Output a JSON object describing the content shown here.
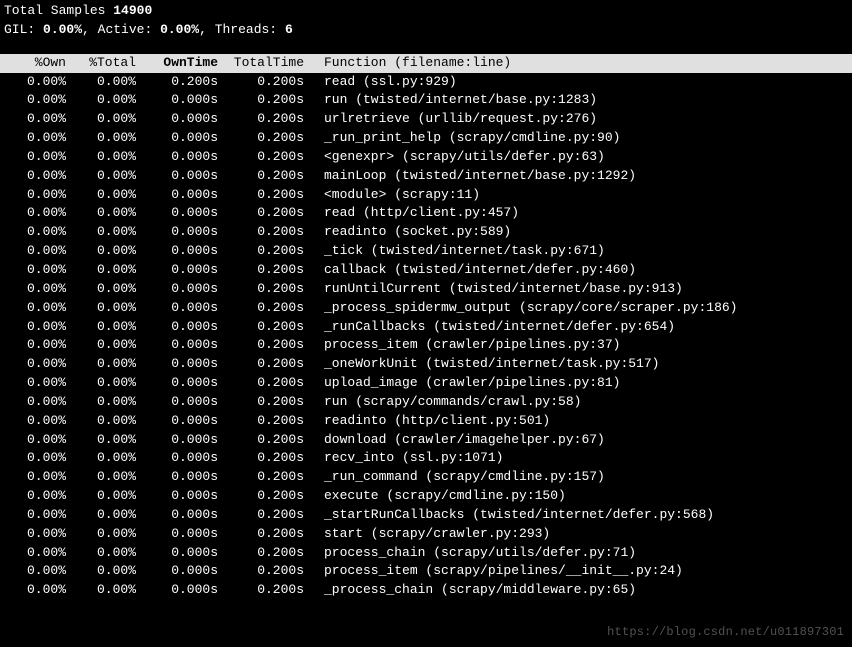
{
  "status": {
    "total_samples_label": "Total Samples",
    "total_samples": "14900",
    "gil_label": "GIL:",
    "gil_value": "0.00%",
    "active_label": "Active:",
    "active_value": "0.00%",
    "threads_label": "Threads:",
    "threads_value": "6"
  },
  "header": {
    "own": "%Own",
    "total": "%Total",
    "owntime": "OwnTime",
    "totaltime": "TotalTime",
    "function": "Function (filename:line)"
  },
  "rows": [
    {
      "own": "0.00%",
      "total": "0.00%",
      "owntime": "0.200s",
      "totaltime": "0.200s",
      "func": "read (ssl.py:929)"
    },
    {
      "own": "0.00%",
      "total": "0.00%",
      "owntime": "0.000s",
      "totaltime": "0.200s",
      "func": "run (twisted/internet/base.py:1283)"
    },
    {
      "own": "0.00%",
      "total": "0.00%",
      "owntime": "0.000s",
      "totaltime": "0.200s",
      "func": "urlretrieve (urllib/request.py:276)"
    },
    {
      "own": "0.00%",
      "total": "0.00%",
      "owntime": "0.000s",
      "totaltime": "0.200s",
      "func": "_run_print_help (scrapy/cmdline.py:90)"
    },
    {
      "own": "0.00%",
      "total": "0.00%",
      "owntime": "0.000s",
      "totaltime": "0.200s",
      "func": "<genexpr> (scrapy/utils/defer.py:63)"
    },
    {
      "own": "0.00%",
      "total": "0.00%",
      "owntime": "0.000s",
      "totaltime": "0.200s",
      "func": "mainLoop (twisted/internet/base.py:1292)"
    },
    {
      "own": "0.00%",
      "total": "0.00%",
      "owntime": "0.000s",
      "totaltime": "0.200s",
      "func": "<module> (scrapy:11)"
    },
    {
      "own": "0.00%",
      "total": "0.00%",
      "owntime": "0.000s",
      "totaltime": "0.200s",
      "func": "read (http/client.py:457)"
    },
    {
      "own": "0.00%",
      "total": "0.00%",
      "owntime": "0.000s",
      "totaltime": "0.200s",
      "func": "readinto (socket.py:589)"
    },
    {
      "own": "0.00%",
      "total": "0.00%",
      "owntime": "0.000s",
      "totaltime": "0.200s",
      "func": "_tick (twisted/internet/task.py:671)"
    },
    {
      "own": "0.00%",
      "total": "0.00%",
      "owntime": "0.000s",
      "totaltime": "0.200s",
      "func": "callback (twisted/internet/defer.py:460)"
    },
    {
      "own": "0.00%",
      "total": "0.00%",
      "owntime": "0.000s",
      "totaltime": "0.200s",
      "func": "runUntilCurrent (twisted/internet/base.py:913)"
    },
    {
      "own": "0.00%",
      "total": "0.00%",
      "owntime": "0.000s",
      "totaltime": "0.200s",
      "func": "_process_spidermw_output (scrapy/core/scraper.py:186)"
    },
    {
      "own": "0.00%",
      "total": "0.00%",
      "owntime": "0.000s",
      "totaltime": "0.200s",
      "func": "_runCallbacks (twisted/internet/defer.py:654)"
    },
    {
      "own": "0.00%",
      "total": "0.00%",
      "owntime": "0.000s",
      "totaltime": "0.200s",
      "func": "process_item (crawler/pipelines.py:37)"
    },
    {
      "own": "0.00%",
      "total": "0.00%",
      "owntime": "0.000s",
      "totaltime": "0.200s",
      "func": "_oneWorkUnit (twisted/internet/task.py:517)"
    },
    {
      "own": "0.00%",
      "total": "0.00%",
      "owntime": "0.000s",
      "totaltime": "0.200s",
      "func": "upload_image (crawler/pipelines.py:81)"
    },
    {
      "own": "0.00%",
      "total": "0.00%",
      "owntime": "0.000s",
      "totaltime": "0.200s",
      "func": "run (scrapy/commands/crawl.py:58)"
    },
    {
      "own": "0.00%",
      "total": "0.00%",
      "owntime": "0.000s",
      "totaltime": "0.200s",
      "func": "readinto (http/client.py:501)"
    },
    {
      "own": "0.00%",
      "total": "0.00%",
      "owntime": "0.000s",
      "totaltime": "0.200s",
      "func": "download (crawler/imagehelper.py:67)"
    },
    {
      "own": "0.00%",
      "total": "0.00%",
      "owntime": "0.000s",
      "totaltime": "0.200s",
      "func": "recv_into (ssl.py:1071)"
    },
    {
      "own": "0.00%",
      "total": "0.00%",
      "owntime": "0.000s",
      "totaltime": "0.200s",
      "func": "_run_command (scrapy/cmdline.py:157)"
    },
    {
      "own": "0.00%",
      "total": "0.00%",
      "owntime": "0.000s",
      "totaltime": "0.200s",
      "func": "execute (scrapy/cmdline.py:150)"
    },
    {
      "own": "0.00%",
      "total": "0.00%",
      "owntime": "0.000s",
      "totaltime": "0.200s",
      "func": "_startRunCallbacks (twisted/internet/defer.py:568)"
    },
    {
      "own": "0.00%",
      "total": "0.00%",
      "owntime": "0.000s",
      "totaltime": "0.200s",
      "func": "start (scrapy/crawler.py:293)"
    },
    {
      "own": "0.00%",
      "total": "0.00%",
      "owntime": "0.000s",
      "totaltime": "0.200s",
      "func": "process_chain (scrapy/utils/defer.py:71)"
    },
    {
      "own": "0.00%",
      "total": "0.00%",
      "owntime": "0.000s",
      "totaltime": "0.200s",
      "func": "process_item (scrapy/pipelines/__init__.py:24)"
    },
    {
      "own": "0.00%",
      "total": "0.00%",
      "owntime": "0.000s",
      "totaltime": "0.200s",
      "func": "_process_chain (scrapy/middleware.py:65)"
    }
  ],
  "watermark": "https://blog.csdn.net/u011897301"
}
